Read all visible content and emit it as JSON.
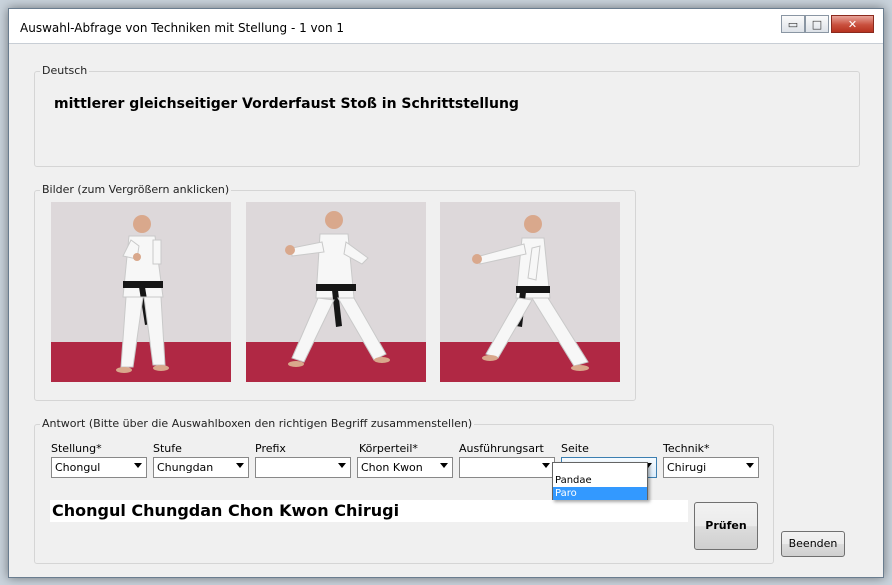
{
  "window": {
    "title": "Auswahl-Abfrage von Techniken mit Stellung - 1 von 1",
    "minimize_label": "▭",
    "maximize_label": "□",
    "close_label": "✕"
  },
  "german_group": {
    "label": "Deutsch",
    "text": "mittlerer gleichseitiger Vorderfaust Stoß in Schrittstellung"
  },
  "images_group": {
    "label": "Bilder (zum Vergrößern anklicken)"
  },
  "answer_group": {
    "label": "Antwort (Bitte über die Auswahlboxen den richtigen Begriff zusammenstellen)",
    "answer_text": "Chongul Chungdan Chon Kwon Chirugi",
    "fields": [
      {
        "label": "Stellung*",
        "value": "Chongul"
      },
      {
        "label": "Stufe",
        "value": "Chungdan"
      },
      {
        "label": "Prefix",
        "value": ""
      },
      {
        "label": "Körperteil*",
        "value": "Chon Kwon"
      },
      {
        "label": "Ausführungsart",
        "value": ""
      },
      {
        "label": "Seite",
        "value": ""
      },
      {
        "label": "Technik*",
        "value": "Chirugi"
      }
    ],
    "check_button": "Prüfen"
  },
  "seite_dropdown": {
    "options": [
      "Pandae",
      "Paro"
    ],
    "highlighted": "Paro"
  },
  "exit_button": "Beenden",
  "colors": {
    "floor": "#b02844",
    "wall": "#ddd8da",
    "gi": "#f7f7f7",
    "belt": "#161616",
    "selection": "#3399ff"
  }
}
